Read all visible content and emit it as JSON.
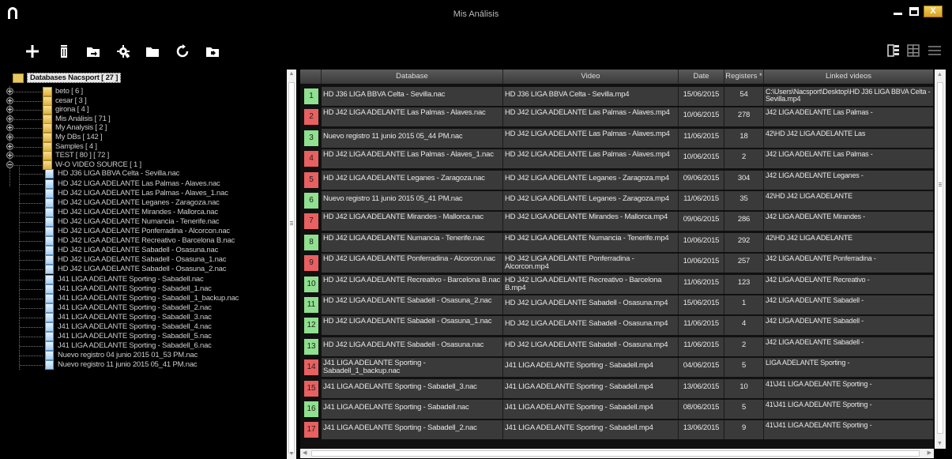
{
  "window": {
    "title": "Mis Análisis",
    "close_label": "X"
  },
  "toolbar": {
    "tools": [
      "plus-icon",
      "trash-icon",
      "folder-import-icon",
      "gear-icon",
      "folder-icon",
      "refresh-icon",
      "folder-export-icon"
    ],
    "views": [
      "list-view-icon",
      "grid-view-icon",
      "lines-view-icon"
    ]
  },
  "tree": {
    "root": "Databases Nacsport [ 27 ]",
    "folders": [
      "beto [ 6 ]",
      "cesar [ 3 ]",
      "girona [ 4 ]",
      "Mis Análisis [ 71 ]",
      "My Analysis [ 2 ]",
      "My DBs [ 142 ]",
      "Samples [ 4 ]",
      "TEST [ 80 ] [ 72 ]",
      "W-O VIDEO SOURCE [ 1 ]"
    ],
    "files": [
      "HD J36 LIGA BBVA Celta - Sevilla.nac",
      "HD J42 LIGA ADELANTE Las Palmas - Alaves.nac",
      "HD J42 LIGA ADELANTE Las Palmas - Alaves_1.nac",
      "HD J42 LIGA ADELANTE Leganes - Zaragoza.nac",
      "HD J42 LIGA ADELANTE Mirandes - Mallorca.nac",
      "HD J42 LIGA ADELANTE Numancia - Tenerife.nac",
      "HD J42 LIGA ADELANTE Ponferradina - Alcorcon.nac",
      "HD J42 LIGA ADELANTE Recreativo - Barcelona B.nac",
      "HD J42 LIGA ADELANTE Sabadell - Osasuna.nac",
      "HD J42 LIGA ADELANTE Sabadell - Osasuna_1.nac",
      "HD J42 LIGA ADELANTE Sabadell - Osasuna_2.nac",
      "J41 LIGA ADELANTE Sporting - Sabadell.nac",
      "J41 LIGA ADELANTE Sporting - Sabadell_1.nac",
      "J41 LIGA ADELANTE Sporting - Sabadell_1_backup.nac",
      "J41 LIGA ADELANTE Sporting - Sabadell_2.nac",
      "J41 LIGA ADELANTE Sporting - Sabadell_3.nac",
      "J41 LIGA ADELANTE Sporting - Sabadell_4.nac",
      "J41 LIGA ADELANTE Sporting - Sabadell_5.nac",
      "J41 LIGA ADELANTE Sporting - Sabadell_6.nac",
      "Nuevo registro 04 junio 2015 01_53 PM.nac",
      "Nuevo registro 11 junio 2015 05_41 PM.nac"
    ]
  },
  "grid": {
    "columns": [
      "Database",
      "Video",
      "Date",
      "Registers *",
      "Linked videos"
    ],
    "rows": [
      {
        "n": "1",
        "status": "green",
        "db": "HD J36 LIGA BBVA Celta - Sevilla.nac",
        "video": "HD J36 LIGA BBVA Celta - Sevilla.mp4",
        "date": "15/06/2015",
        "reg": "54",
        "linked": "C:\\Users\\Nacsport\\Desktop\\HD J36 LIGA BBVA Celta - Sevilla.mp4"
      },
      {
        "n": "2",
        "status": "red",
        "db": "HD J42 LIGA ADELANTE Las Palmas - Alaves.nac",
        "video": "HD J42 LIGA ADELANTE Las Palmas - Alaves.mp4",
        "date": "10/06/2015",
        "reg": "278",
        "linked": "J42 LIGA ADELANTE Las Palmas -"
      },
      {
        "n": "3",
        "status": "green",
        "db": "Nuevo registro 11 junio 2015 05_44 PM.nac",
        "video": "HD J42 LIGA ADELANTE Las Palmas - Alaves.mp4",
        "date": "11/06/2015",
        "reg": "18",
        "linked": "42\\HD J42 LIGA ADELANTE Las"
      },
      {
        "n": "4",
        "status": "red",
        "db": "HD J42 LIGA ADELANTE Las Palmas - Alaves_1.nac",
        "video": "HD J42 LIGA ADELANTE Las Palmas - Alaves.mp4",
        "date": "10/06/2015",
        "reg": "2",
        "linked": "J42 LIGA ADELANTE Las Palmas -"
      },
      {
        "n": "5",
        "status": "red",
        "db": "HD J42 LIGA ADELANTE Leganes - Zaragoza.nac",
        "video": "HD J42 LIGA ADELANTE Leganes - Zaragoza.mp4",
        "date": "09/06/2015",
        "reg": "304",
        "linked": "J42 LIGA ADELANTE Leganes -"
      },
      {
        "n": "6",
        "status": "green",
        "db": "Nuevo registro 11 junio 2015 05_41 PM.nac",
        "video": "HD J42 LIGA ADELANTE Leganes - Zaragoza.mp4",
        "date": "11/06/2015",
        "reg": "35",
        "linked": "42\\HD J42 LIGA ADELANTE"
      },
      {
        "n": "7",
        "status": "red",
        "db": "HD J42 LIGA ADELANTE Mirandes - Mallorca.nac",
        "video": "HD J42 LIGA ADELANTE Mirandes - Mallorca.mp4",
        "date": "09/06/2015",
        "reg": "286",
        "linked": "J42 LIGA ADELANTE Mirandes -"
      },
      {
        "n": "8",
        "status": "green",
        "db": "HD J42 LIGA ADELANTE Numancia - Tenerife.nac",
        "video": "HD J42 LIGA ADELANTE Numancia - Tenerife.mp4",
        "date": "10/06/2015",
        "reg": "292",
        "linked": "42\\HD J42 LIGA ADELANTE"
      },
      {
        "n": "9",
        "status": "red",
        "db": "HD J42 LIGA ADELANTE Ponferradina - Alcorcon.nac",
        "video": "HD J42 LIGA ADELANTE Ponferradina - Alcorcon.mp4",
        "date": "10/06/2015",
        "reg": "257",
        "linked": "J42 LIGA ADELANTE Ponferradina -"
      },
      {
        "n": "10",
        "status": "green",
        "db": "HD J42 LIGA ADELANTE Recreativo - Barcelona B.nac",
        "video": "HD J42 LIGA ADELANTE Recreativo - Barcelona B.mp4",
        "date": "11/06/2015",
        "reg": "123",
        "linked": "J42 LIGA ADELANTE Recreativo -"
      },
      {
        "n": "11",
        "status": "green",
        "db": "HD J42 LIGA ADELANTE Sabadell - Osasuna_2.nac",
        "video": "HD J42 LIGA ADELANTE Sabadell - Osasuna.mp4",
        "date": "15/06/2015",
        "reg": "1",
        "linked": "J42 LIGA ADELANTE Sabadell -"
      },
      {
        "n": "12",
        "status": "green",
        "db": "HD J42 LIGA ADELANTE Sabadell - Osasuna_1.nac",
        "video": "HD J42 LIGA ADELANTE Sabadell - Osasuna.mp4",
        "date": "11/06/2015",
        "reg": "4",
        "linked": "J42 LIGA ADELANTE Sabadell -"
      },
      {
        "n": "13",
        "status": "green",
        "db": "HD J42 LIGA ADELANTE Sabadell - Osasuna.nac",
        "video": "HD J42 LIGA ADELANTE Sabadell - Osasuna.mp4",
        "date": "11/06/2015",
        "reg": "2",
        "linked": "J42 LIGA ADELANTE Sabadell -"
      },
      {
        "n": "14",
        "status": "red",
        "db": "J41 LIGA ADELANTE Sporting - Sabadell_1_backup.nac",
        "video": "J41 LIGA ADELANTE Sporting - Sabadell.mp4",
        "date": "04/06/2015",
        "reg": "5",
        "linked": "LIGA ADELANTE Sporting -"
      },
      {
        "n": "15",
        "status": "red",
        "db": "J41 LIGA ADELANTE Sporting - Sabadell_3.nac",
        "video": "J41 LIGA ADELANTE Sporting - Sabadell.mp4",
        "date": "13/06/2015",
        "reg": "10",
        "linked": "41\\J41 LIGA ADELANTE Sporting -"
      },
      {
        "n": "16",
        "status": "green",
        "db": "J41 LIGA ADELANTE Sporting - Sabadell.nac",
        "video": "J41 LIGA ADELANTE Sporting - Sabadell.mp4",
        "date": "08/06/2015",
        "reg": "5",
        "linked": "41\\J41 LIGA ADELANTE Sporting -"
      },
      {
        "n": "17",
        "status": "red",
        "db": "J41 LIGA ADELANTE Sporting - Sabadell_2.nac",
        "video": "J41 LIGA ADELANTE Sporting - Sabadell.mp4",
        "date": "13/06/2015",
        "reg": "9",
        "linked": "41\\J41 LIGA ADELANTE Sporting -"
      }
    ]
  },
  "colors": {
    "status_green": "#8fe08f",
    "status_red": "#e86060",
    "folder": "#e8c860",
    "file": "#a8cff0",
    "cell_bg": "#3a3a3a"
  }
}
